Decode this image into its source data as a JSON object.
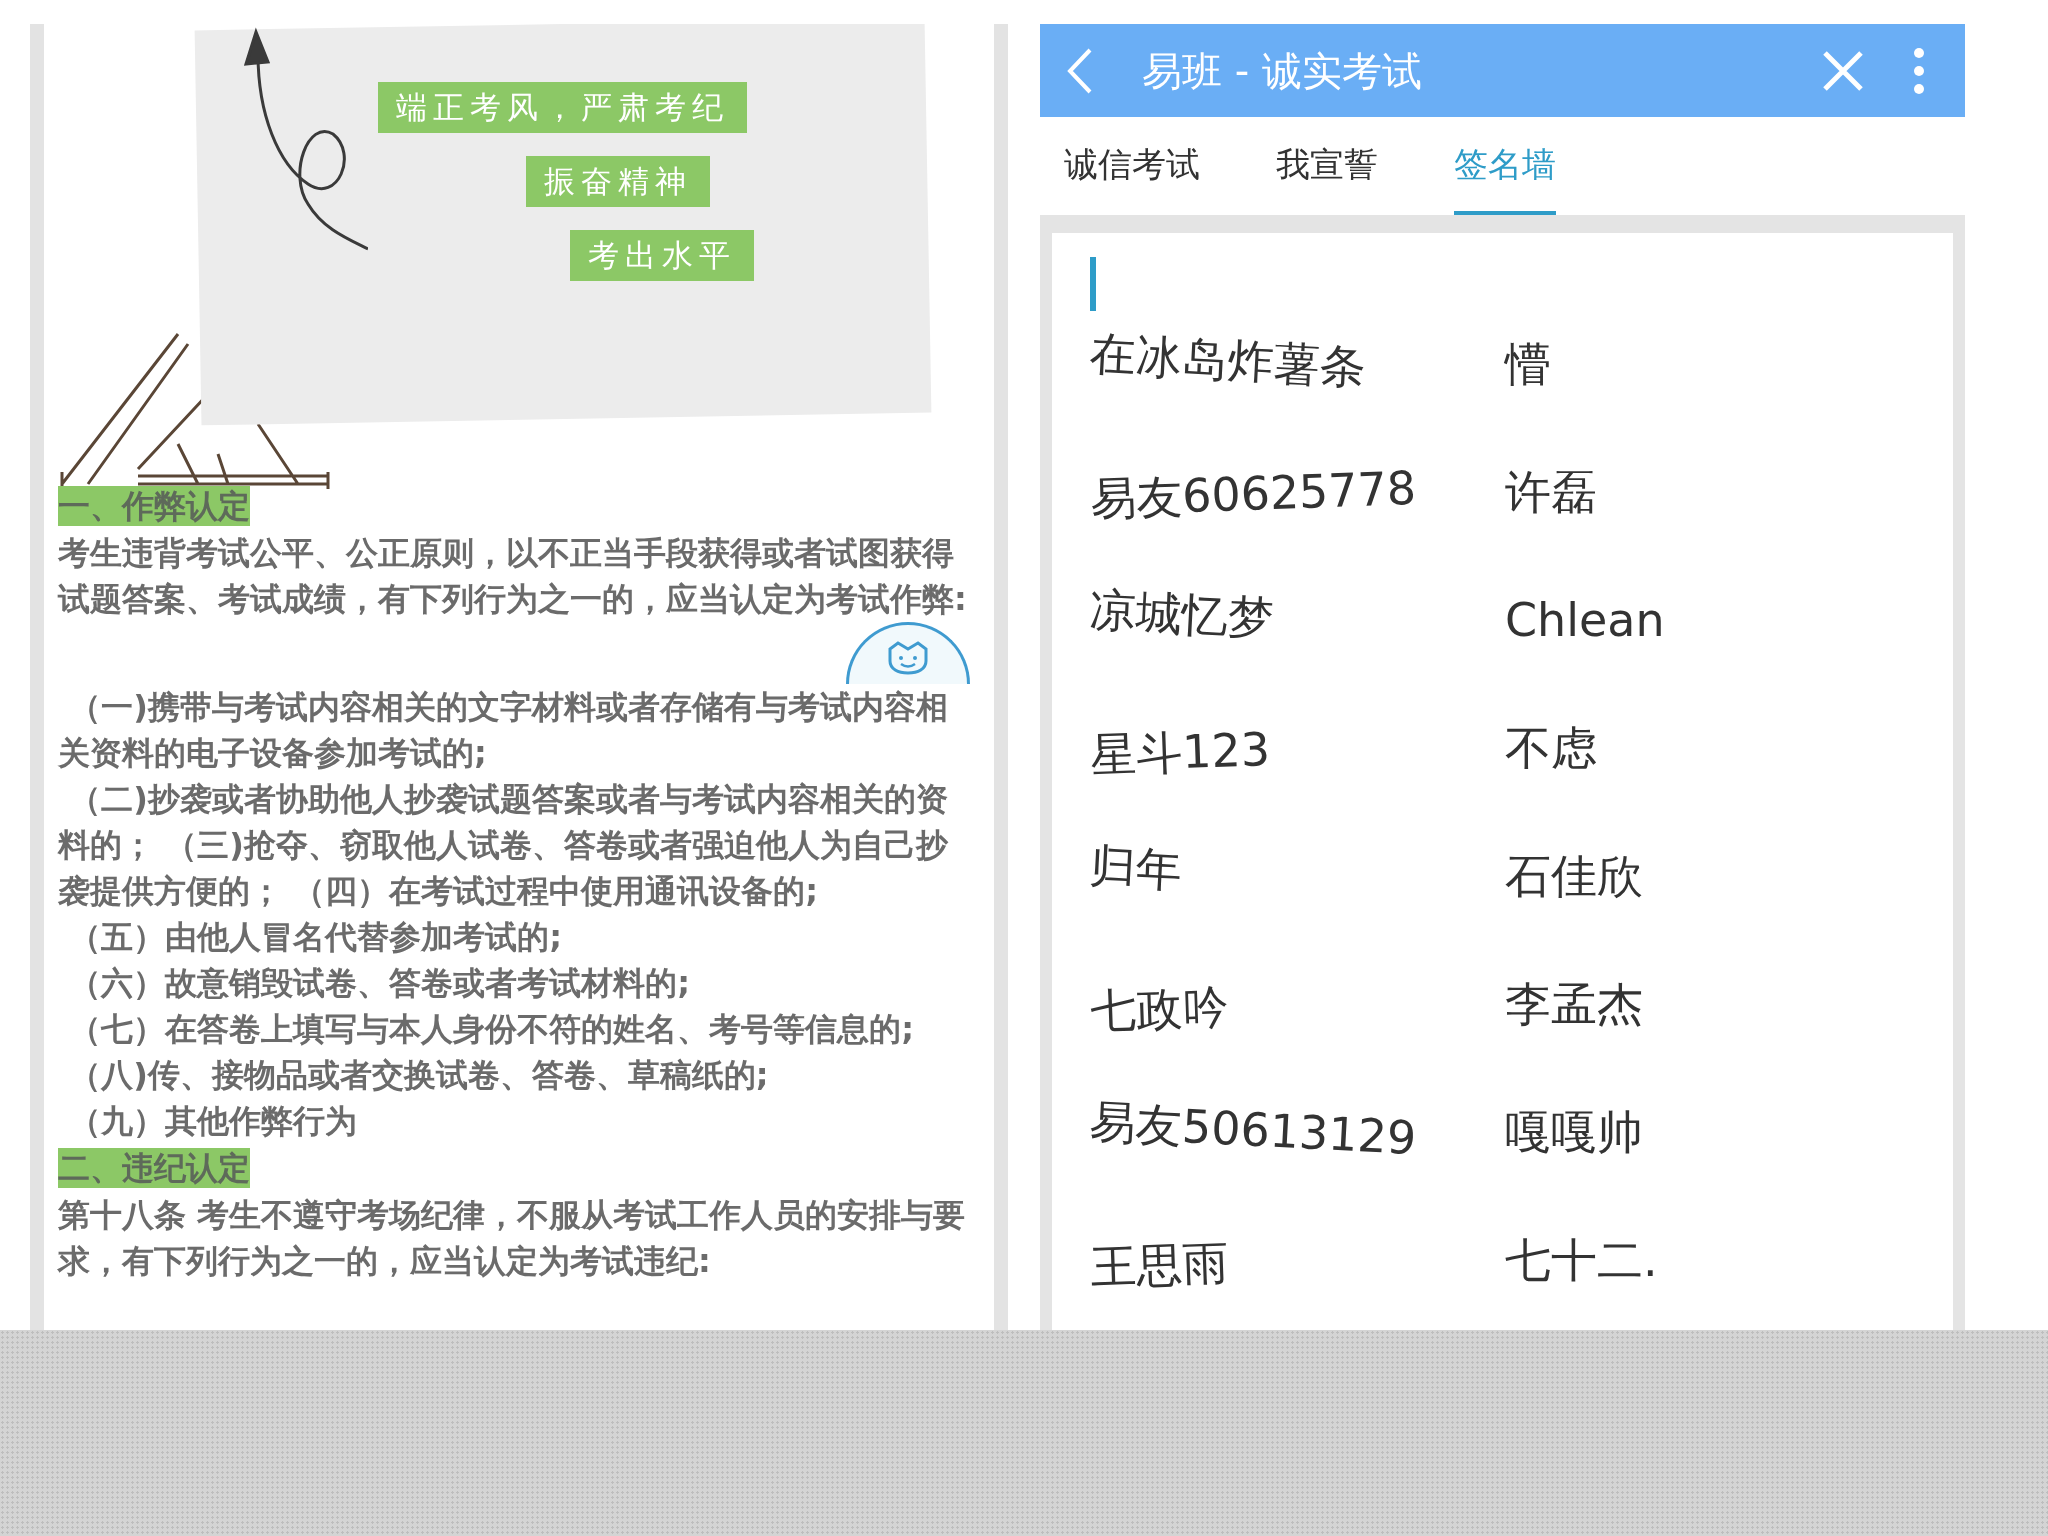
{
  "left_panel": {
    "poster": {
      "slogans": [
        "端正考风，严肃考纪",
        "振奋精神",
        "考出水平"
      ]
    },
    "sections": [
      {
        "heading": "一、作弊认定",
        "paragraphs": [
          {
            "kind": "lead",
            "text": "考生违背考试公平、公正原则，以不正当手段获得或者试图获得试题答案、考试成绩，有下列行为之一的，应当认定为考试作弊:"
          },
          {
            "kind": "item",
            "text": "（一)携带与考试内容相关的文字材料或者存储有与考试内容相关资料的电子设备参加考试的;"
          },
          {
            "kind": "item",
            "text": "（二)抄袭或者协助他人抄袭试题答案或者与考试内容相关的资料的； （三)抢夺、窃取他人试卷、答卷或者强迫他人为自己抄袭提供方便的； （四）在考试过程中使用通讯设备的;"
          },
          {
            "kind": "item",
            "text": "（五）由他人冒名代替参加考试的;"
          },
          {
            "kind": "item",
            "text": "（六）故意销毁试卷、答卷或者考试材料的;"
          },
          {
            "kind": "item",
            "text": "（七）在答卷上填写与本人身份不符的姓名、考号等信息的;"
          },
          {
            "kind": "item",
            "text": "（八)传、接物品或者交换试卷、答卷、草稿纸的;"
          },
          {
            "kind": "item",
            "text": "（九）其他作弊行为"
          }
        ]
      },
      {
        "heading": "二、违纪认定",
        "paragraphs": [
          {
            "kind": "lead",
            "text": "第十八条 考生不遵守考场纪律，不服从考试工作人员的安排与要求，有下列行为之一的，应当认定为考试违纪:"
          }
        ]
      }
    ]
  },
  "right_panel": {
    "header": {
      "title": "易班 - 诚实考试"
    },
    "tabs": [
      {
        "label": "诚信考试",
        "selected": false
      },
      {
        "label": "我宣誓",
        "selected": false
      },
      {
        "label": "签名墙",
        "selected": true
      }
    ],
    "signatures": [
      {
        "name": "在冰岛炸薯条"
      },
      {
        "name": "懵"
      },
      {
        "name": "易友60625778"
      },
      {
        "name": "许磊"
      },
      {
        "name": "凉城忆梦"
      },
      {
        "name": "Chlean"
      },
      {
        "name": "星斗123"
      },
      {
        "name": "不虑"
      },
      {
        "name": "归年"
      },
      {
        "name": "石佳欣"
      },
      {
        "name": "七政吟"
      },
      {
        "name": "李孟杰"
      },
      {
        "name": "易友50613129"
      },
      {
        "name": "嘎嘎帅"
      },
      {
        "name": "王思雨"
      },
      {
        "name": "七十二."
      }
    ]
  }
}
